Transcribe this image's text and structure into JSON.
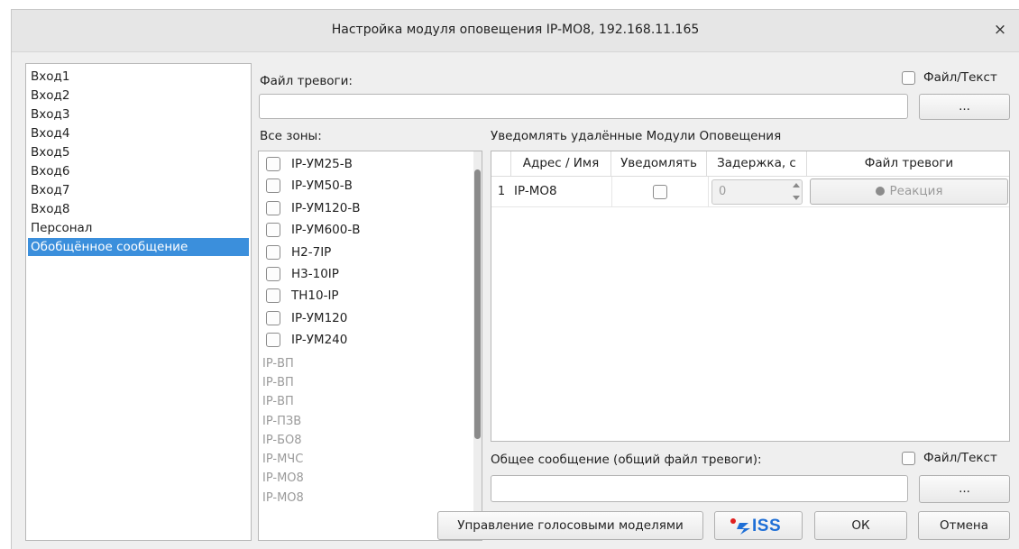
{
  "window": {
    "title": "Настройка модуля оповещения IP-МО8, 192.168.11.165",
    "close_symbol": "×"
  },
  "left_list": {
    "items": [
      "Вход1",
      "Вход2",
      "Вход3",
      "Вход4",
      "Вход5",
      "Вход6",
      "Вход7",
      "Вход8",
      "Персонал",
      "Обобщённое сообщение"
    ],
    "selected": "Обобщённое сообщение"
  },
  "alarm_file": {
    "label": "Файл тревоги:",
    "value": "",
    "file_text_label": "Файл/Текст",
    "file_text_checked": false,
    "browse_label": "..."
  },
  "zones": {
    "label": "Все зоны:",
    "enabled": [
      "IP-УМ25-В",
      "IP-УМ50-В",
      "IP-УМ120-В",
      "IP-УМ600-В",
      "Н2-7IP",
      "Н3-10IP",
      "ТН10-IP",
      "IP-УМ120",
      "IP-УМ240"
    ],
    "disabled": [
      "IP-ВП",
      "IP-ВП",
      "IP-ВП",
      "IP-ПЗВ",
      "IP-БО8",
      "IP-МЧС",
      "IP-МО8",
      "IP-МО8"
    ]
  },
  "notify": {
    "label": "Уведомлять удалённые Модули Оповещения",
    "columns": {
      "address": "Адрес / Имя",
      "notify": "Уведомлять",
      "delay": "Задержка, с",
      "file": "Файл тревоги"
    },
    "rows": [
      {
        "index": "1",
        "address": "IP-МО8",
        "notify": false,
        "delay": "0",
        "file_button": "Реакция"
      }
    ]
  },
  "general_message": {
    "label": "Общее сообщение (общий файл тревоги):",
    "value": "",
    "file_text_label": "Файл/Текст",
    "file_text_checked": false,
    "browse_label": "..."
  },
  "footer": {
    "voice_models_label": "Управление голосовыми моделями",
    "logo_text": "ISS",
    "ok_label": "ОК",
    "cancel_label": "Отмена"
  },
  "colors": {
    "selection": "#3b8fdc",
    "logo_red": "#e02020",
    "logo_blue": "#1f6fd6"
  }
}
